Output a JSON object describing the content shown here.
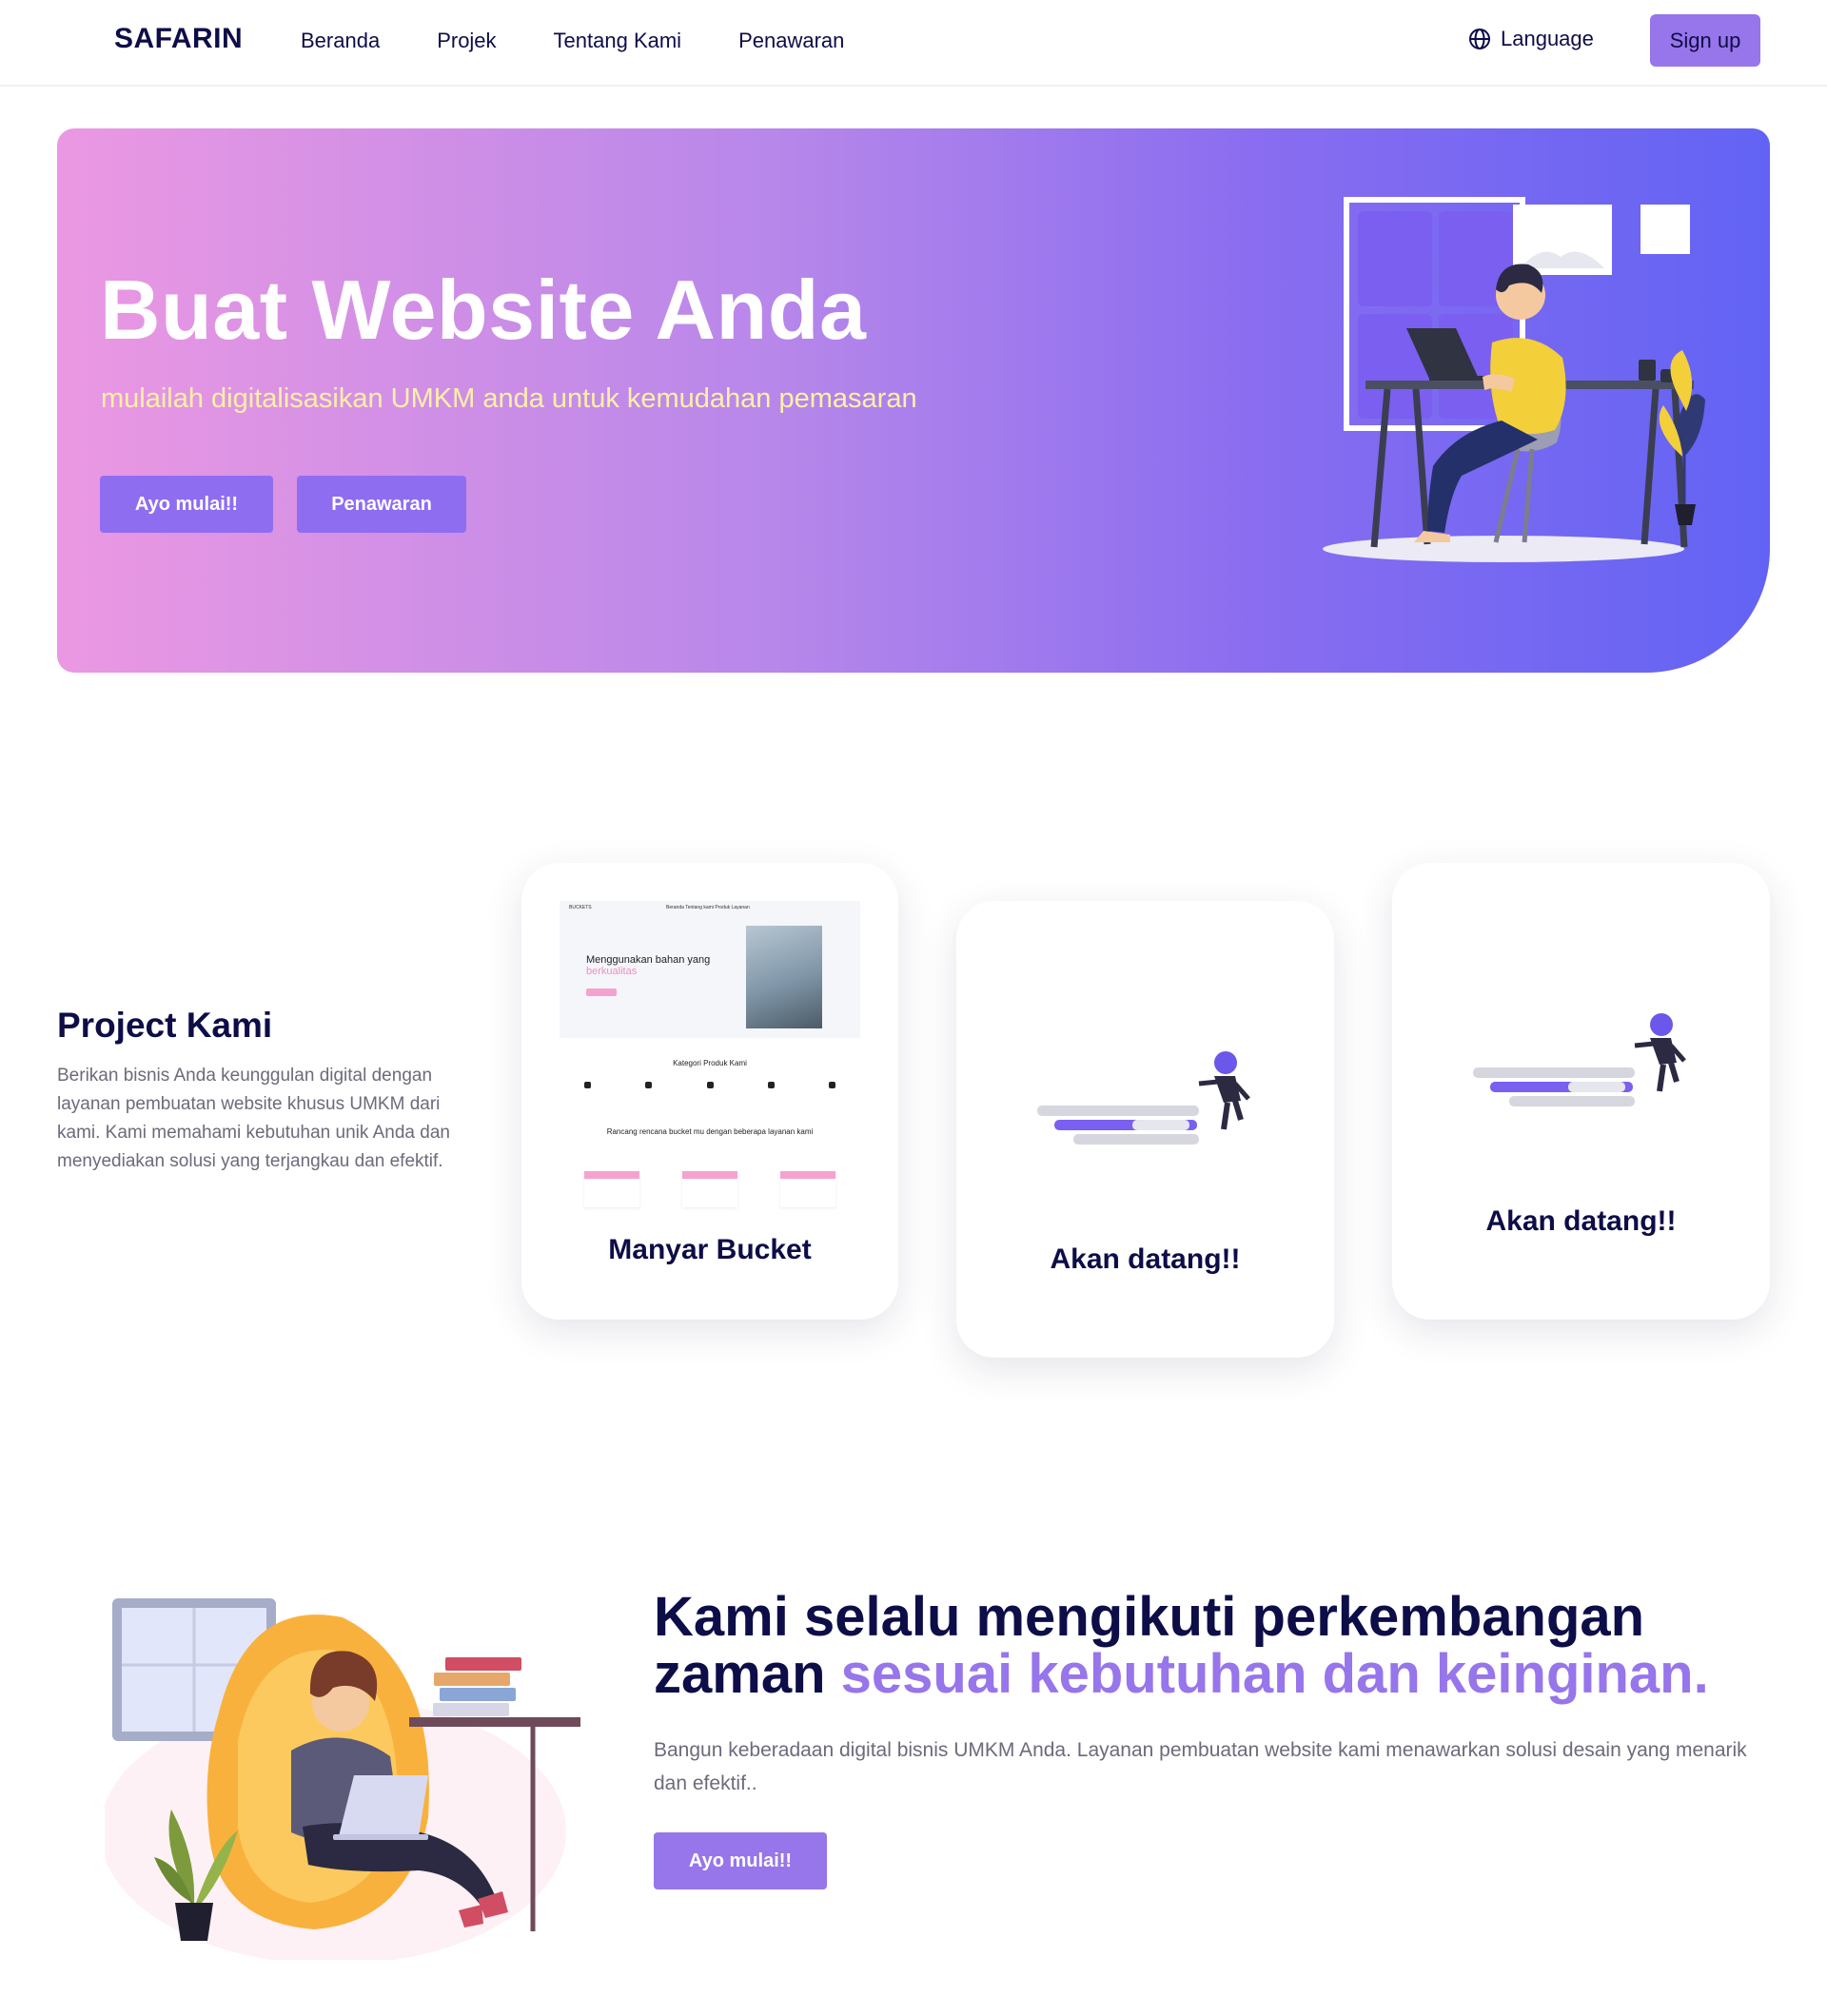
{
  "nav": {
    "brand": "SAFARIN",
    "links": [
      "Beranda",
      "Projek",
      "Tentang Kami",
      "Penawaran"
    ],
    "language": "Language",
    "signup": "Sign up"
  },
  "hero": {
    "title": "Buat Website Anda",
    "subtitle": "mulailah digitalisasikan UMKM anda untuk kemudahan pemasaran",
    "btn_start": "Ayo mulai!!",
    "btn_offer": "Penawaran"
  },
  "projects": {
    "title": "Project Kami",
    "description": "Berikan bisnis Anda keunggulan digital dengan layanan pembuatan website khusus UMKM dari kami. Kami memahami kebutuhan unik Anda dan menyediakan solusi yang terjangkau dan efektif.",
    "cards": [
      {
        "label": "Manyar Bucket"
      },
      {
        "label": "Akan datang!!"
      },
      {
        "label": "Akan datang!!"
      }
    ],
    "preview": {
      "brand": "BUCKETS",
      "nav_items": "Beranda   Tentang kami   Produk   Layanan",
      "headline_1": "Menggunakan bahan yang",
      "headline_2": "berkualitas",
      "category_title": "Kategori Produk Kami",
      "plan_title": "Rancang rencana bucket mu dengan beberapa layanan kami"
    }
  },
  "about": {
    "title_part1": "Kami selalu mengikuti perkembangan zaman ",
    "title_highlight": "sesuai kebutuhan dan keinginan.",
    "description": "Bangun keberadaan digital bisnis UMKM Anda. Layanan pembuatan website kami menawarkan solusi desain yang menarik dan efektif..",
    "btn": "Ayo mulai!!"
  },
  "colors": {
    "primary": "#9775ea",
    "navy": "#0d0d48",
    "hero_gradient_start": "#eb98e2",
    "hero_gradient_end": "#6263f4",
    "hero_subtitle": "#fdf0a8"
  },
  "icons": {
    "language": "globe-icon"
  }
}
